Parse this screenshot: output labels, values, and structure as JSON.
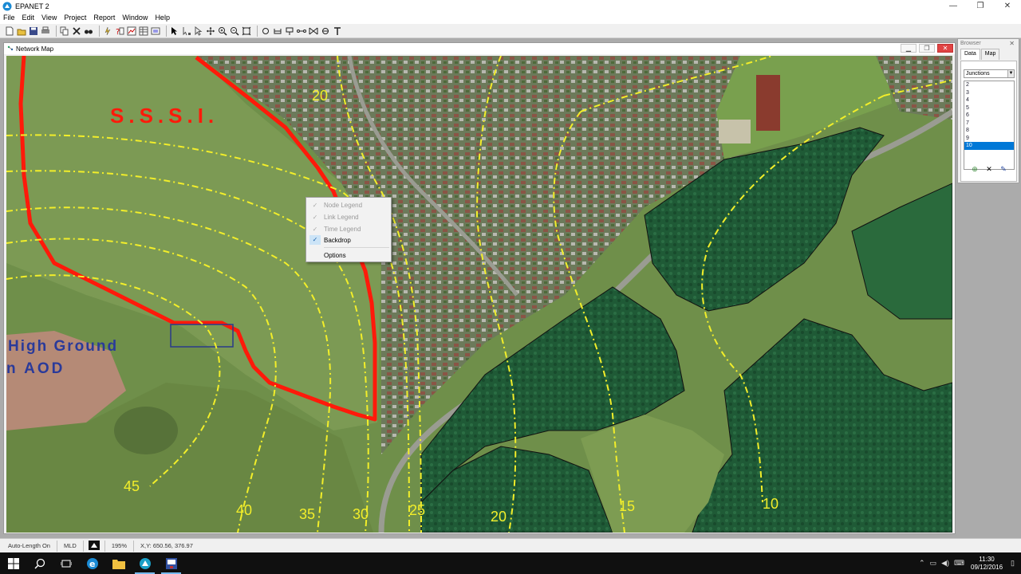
{
  "window": {
    "title": "EPANET 2",
    "controls": [
      "—",
      "❐",
      "✕"
    ]
  },
  "menu": [
    "File",
    "Edit",
    "View",
    "Project",
    "Report",
    "Window",
    "Help"
  ],
  "toolbar": {
    "icons": [
      "new-file-icon",
      "open-file-icon",
      "save-icon",
      "print-icon",
      "copy-icon",
      "delete-icon",
      "find-icon",
      "run-icon",
      "query-icon",
      "graph-icon",
      "table-icon",
      "options-icon",
      "select-icon",
      "vertex-icon",
      "region-icon",
      "pan-icon",
      "zoom-in-icon",
      "zoom-out-icon",
      "full-extent-icon",
      "junction-icon",
      "reservoir-icon",
      "tank-icon",
      "pipe-icon",
      "pump-icon",
      "valve-icon",
      "label-icon"
    ]
  },
  "map_window": {
    "title": "Network Map",
    "labels": {
      "sssi": "S.S.S.I.",
      "high_ground_1": "High Ground",
      "high_ground_2": "n AOD",
      "contours": [
        "20",
        "45",
        "40",
        "35",
        "30",
        "25",
        "20",
        "15",
        "10"
      ]
    },
    "colors": {
      "boundary": "#ff1a0a",
      "contour": "#f2ee2a",
      "label_blue": "#2a3a9a"
    }
  },
  "context_menu": {
    "items": [
      {
        "label": "Node Legend",
        "checked": true,
        "enabled": false
      },
      {
        "label": "Link Legend",
        "checked": true,
        "enabled": false
      },
      {
        "label": "Time Legend",
        "checked": true,
        "enabled": false
      },
      {
        "label": "Backdrop",
        "checked": true,
        "enabled": true
      },
      {
        "label": "Options",
        "checked": false,
        "enabled": true
      }
    ]
  },
  "browser": {
    "title": "Browser",
    "tabs": [
      {
        "label": "Data",
        "active": true
      },
      {
        "label": "Map",
        "active": false
      }
    ],
    "category": "Junctions",
    "items": [
      "2",
      "3",
      "4",
      "5",
      "6",
      "7",
      "8",
      "9",
      "10"
    ],
    "selected": "10"
  },
  "statusbar": {
    "auto_length": "Auto-Length On",
    "units": "MLD",
    "zoom": "195%",
    "xy": "X,Y: 650.56, 376.97"
  },
  "taskbar": {
    "time": "11:30",
    "date": "09/12/2016"
  }
}
